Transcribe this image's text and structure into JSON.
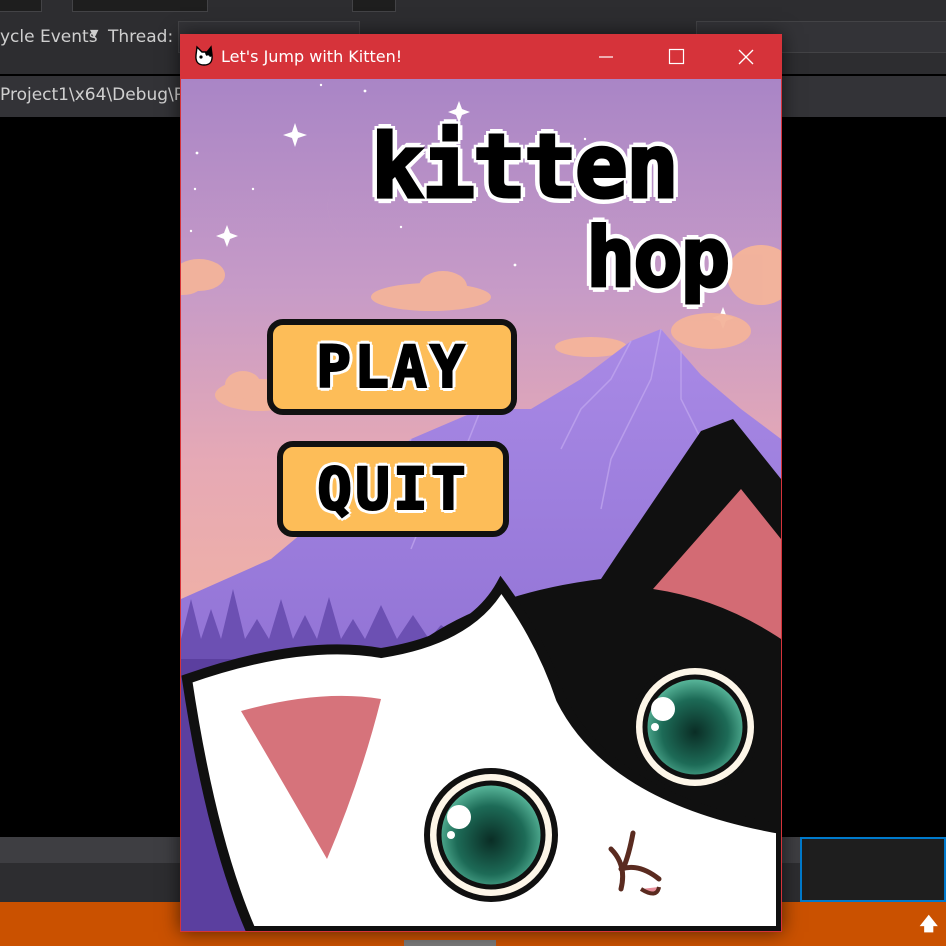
{
  "ide": {
    "toolbar": {
      "lifecycle_label": "ycle Events",
      "thread_label": "Thread:"
    },
    "path": "Project1\\x64\\Debug\\P",
    "colors": {
      "statusbar": "#ca5100",
      "accent": "#007acc"
    }
  },
  "window": {
    "title": "Let's Jump with Kitten!",
    "controls": [
      "minimize-icon",
      "maximize-icon",
      "close-icon"
    ],
    "titlebar_color": "#d6333a"
  },
  "game": {
    "logo": {
      "line1": "kitten",
      "line2": "hop"
    },
    "buttons": {
      "play": "PLAY",
      "quit": "QUIT"
    },
    "colors": {
      "button": "#fdbd58",
      "sky_top": "#b088c8",
      "sky_bottom": "#f0b2a4",
      "mountain": "#9b7fd9"
    }
  }
}
